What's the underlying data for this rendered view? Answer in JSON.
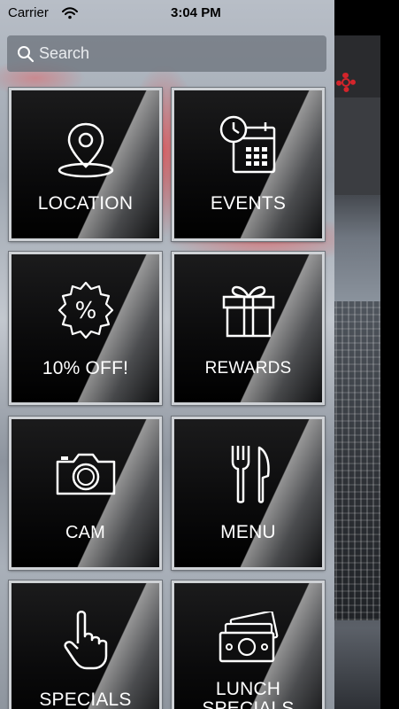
{
  "status_bar": {
    "carrier": "Carrier",
    "time": "3:04 PM"
  },
  "search": {
    "placeholder": "Search"
  },
  "tiles": [
    {
      "label": "LOCATION",
      "icon": "location-pin-icon"
    },
    {
      "label": "EVENTS",
      "icon": "calendar-clock-icon"
    },
    {
      "label": "10% OFF!",
      "icon": "percent-badge-icon"
    },
    {
      "label": "REWARDS",
      "icon": "gift-icon"
    },
    {
      "label": "CAM",
      "icon": "camera-icon"
    },
    {
      "label": "MENU",
      "icon": "fork-knife-icon"
    },
    {
      "label": "SPECIALS",
      "icon": "pointing-hand-icon"
    },
    {
      "label_line1": "LUNCH",
      "label_line2": "SPECIALS",
      "icon": "money-icon"
    }
  ],
  "colors": {
    "accent": "#d4242b",
    "tile_bg": "#0b0b0c",
    "tile_text": "#ffffff"
  }
}
